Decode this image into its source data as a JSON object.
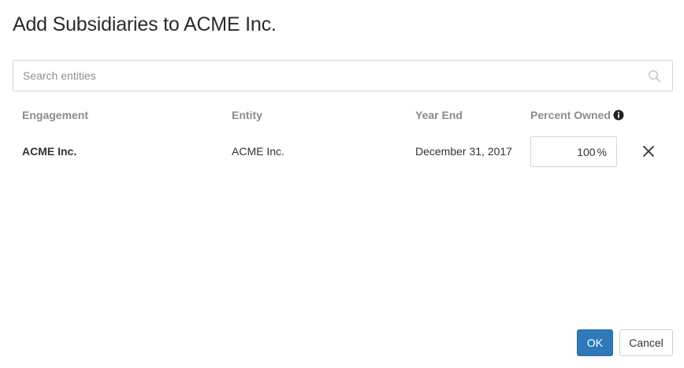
{
  "dialog": {
    "title": "Add Subsidiaries to ACME Inc."
  },
  "search": {
    "placeholder": "Search entities",
    "icon": "search-icon"
  },
  "table": {
    "headers": {
      "engagement": "Engagement",
      "entity": "Entity",
      "year_end": "Year End",
      "percent_owned": "Percent Owned"
    },
    "rows": [
      {
        "engagement": "ACME Inc.",
        "entity": "ACME Inc.",
        "year_end": "December 31, 2017",
        "percent_owned": "100",
        "percent_unit": "%"
      }
    ]
  },
  "footer": {
    "ok_label": "OK",
    "cancel_label": "Cancel"
  },
  "colors": {
    "primary": "#2f79b9",
    "header_text": "#8c8c8c"
  }
}
